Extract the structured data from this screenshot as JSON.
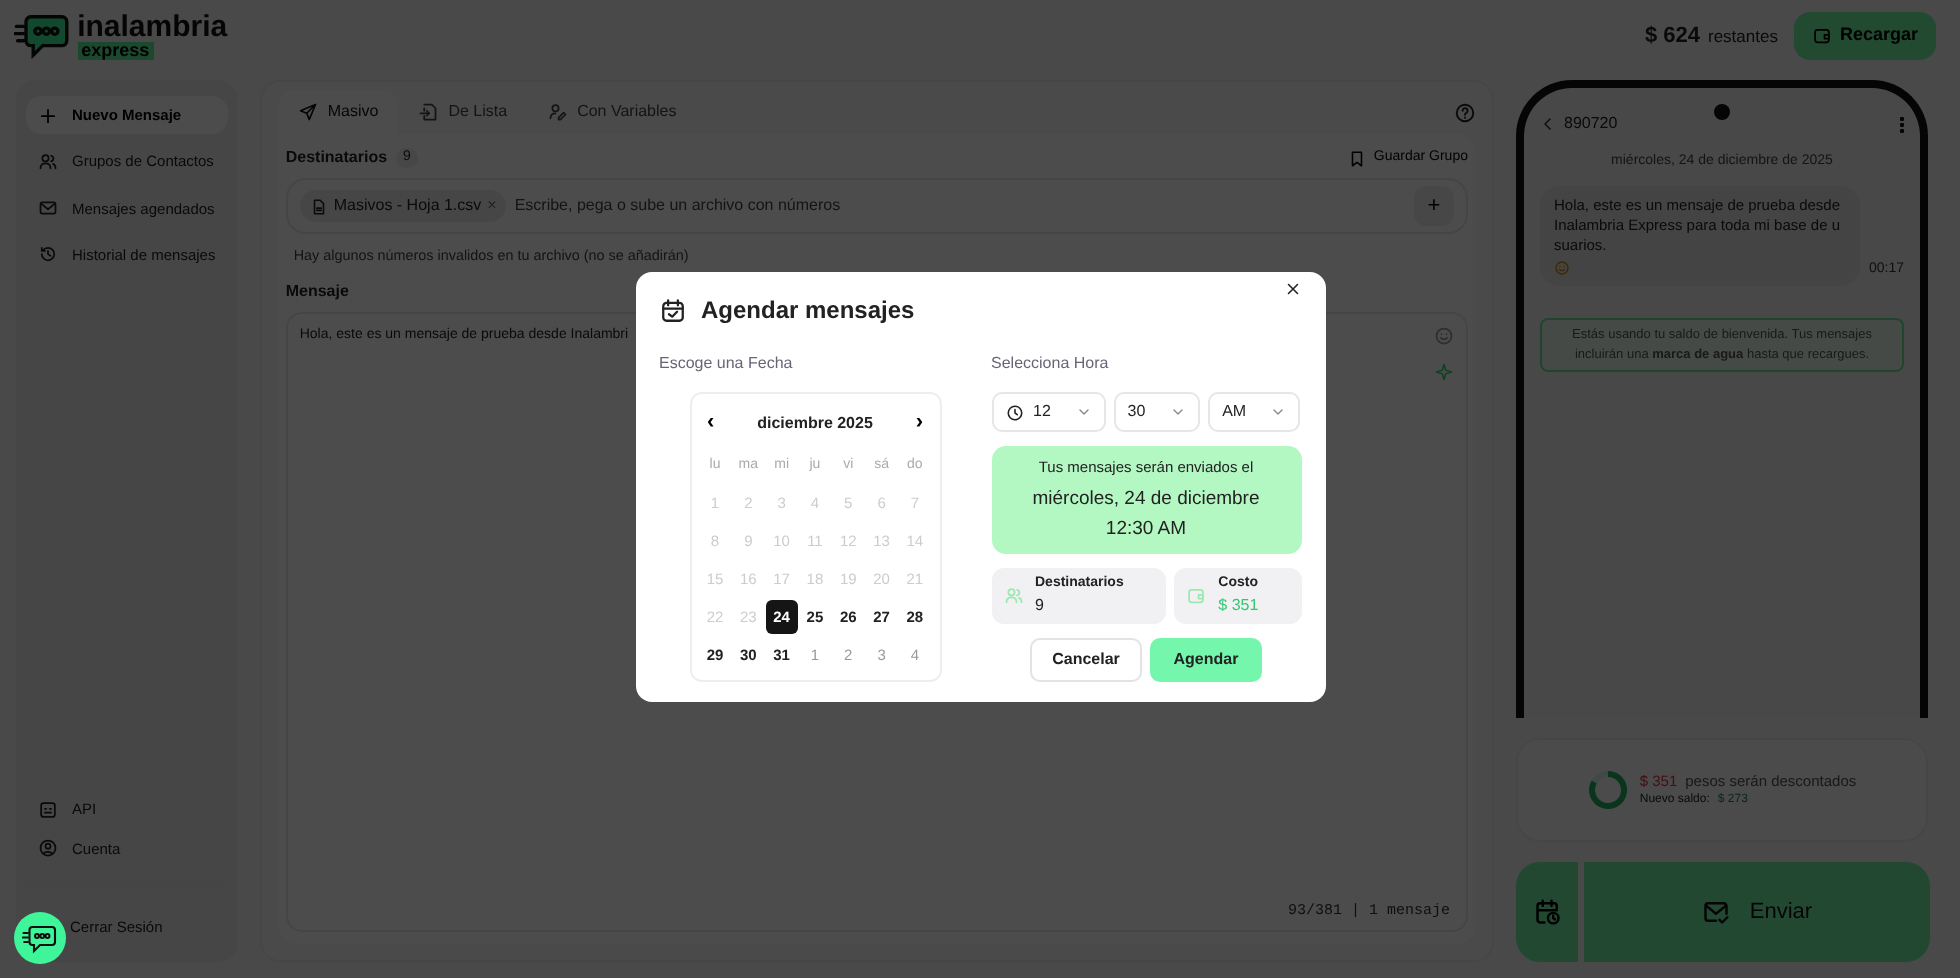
{
  "header": {
    "brand": "inalambria",
    "brand_sub": "express",
    "balance": "$ 624",
    "balance_suffix": "restantes",
    "recharge": "Recargar"
  },
  "sidebar": {
    "items": [
      {
        "label": "Nuevo Mensaje",
        "selected": true
      },
      {
        "label": "Grupos de Contactos",
        "selected": false
      },
      {
        "label": "Mensajes agendados",
        "selected": false
      },
      {
        "label": "Historial de mensajes",
        "selected": false
      }
    ],
    "bottom_items": [
      {
        "label": "API",
        "selected": false
      },
      {
        "label": "Cuenta",
        "selected": false
      }
    ],
    "logout": "Cerrar Sesión"
  },
  "tabs": [
    {
      "label": "Masivo",
      "selected": true
    },
    {
      "label": "De Lista",
      "selected": false
    },
    {
      "label": "Con Variables",
      "selected": false
    }
  ],
  "recipients": {
    "label": "Destinatarios",
    "count": "9",
    "save": "Guardar Grupo",
    "chip": "Masivos - Hoja 1.csv",
    "chip_close": "×",
    "placeholder": "Escribe, pega o sube un archivo con números",
    "add": "+",
    "warning": "Hay algunos números invalidos en tu archivo (no se añadirán)"
  },
  "message": {
    "label": "Mensaje",
    "text": "Hola, este es un mensaje de prueba desde Inalambri",
    "counter": "93/381 | 1 mensaje"
  },
  "phone": {
    "contact": "890720",
    "date": "miércoles, 24 de diciembre de 2025",
    "bubble": "Hola, este es un mensaje de prueba desde Inalambria Express para toda mi base de usuarios.",
    "time": "00:17",
    "notice": "Estás usando tu saldo de bienvenida. Tus mensajes incluirán una **marca de agua** hasta que recargues."
  },
  "summary": {
    "amount": "$ 351",
    "text": "pesos serán descontados",
    "new_balance_label": "Nuevo saldo:",
    "new_balance": "$ 273"
  },
  "send": {
    "label": "Enviar"
  },
  "modal": {
    "title": "Agendar mensajes",
    "date_label": "Escoge una Fecha",
    "month": "diciembre 2025",
    "prev": "‹",
    "next": "›",
    "weekdays": [
      "lu",
      "ma",
      "mi",
      "ju",
      "vi",
      "sá",
      "do"
    ],
    "weeks": [
      [
        {
          "label": "1",
          "kind": "past",
          "selected": false
        },
        {
          "label": "2",
          "kind": "past",
          "selected": false
        },
        {
          "label": "3",
          "kind": "past",
          "selected": false
        },
        {
          "label": "4",
          "kind": "past",
          "selected": false
        },
        {
          "label": "5",
          "kind": "past",
          "selected": false
        },
        {
          "label": "6",
          "kind": "past",
          "selected": false
        },
        {
          "label": "7",
          "kind": "past",
          "selected": false
        }
      ],
      [
        {
          "label": "8",
          "kind": "past",
          "selected": false
        },
        {
          "label": "9",
          "kind": "past",
          "selected": false
        },
        {
          "label": "10",
          "kind": "past",
          "selected": false
        },
        {
          "label": "11",
          "kind": "past",
          "selected": false
        },
        {
          "label": "12",
          "kind": "past",
          "selected": false
        },
        {
          "label": "13",
          "kind": "past",
          "selected": false
        },
        {
          "label": "14",
          "kind": "past",
          "selected": false
        }
      ],
      [
        {
          "label": "15",
          "kind": "past",
          "selected": false
        },
        {
          "label": "16",
          "kind": "past",
          "selected": false
        },
        {
          "label": "17",
          "kind": "past",
          "selected": false
        },
        {
          "label": "18",
          "kind": "past",
          "selected": false
        },
        {
          "label": "19",
          "kind": "past",
          "selected": false
        },
        {
          "label": "20",
          "kind": "past",
          "selected": false
        },
        {
          "label": "21",
          "kind": "past",
          "selected": false
        }
      ],
      [
        {
          "label": "22",
          "kind": "past",
          "selected": false
        },
        {
          "label": "23",
          "kind": "past",
          "selected": false
        },
        {
          "label": "24",
          "kind": "current",
          "selected": true
        },
        {
          "label": "25",
          "kind": "current",
          "selected": false
        },
        {
          "label": "26",
          "kind": "current",
          "selected": false
        },
        {
          "label": "27",
          "kind": "current",
          "selected": false
        },
        {
          "label": "28",
          "kind": "current",
          "selected": false
        }
      ],
      [
        {
          "label": "29",
          "kind": "current",
          "selected": false
        },
        {
          "label": "30",
          "kind": "current",
          "selected": false
        },
        {
          "label": "31",
          "kind": "current",
          "selected": false
        },
        {
          "label": "1",
          "kind": "next",
          "selected": false
        },
        {
          "label": "2",
          "kind": "next",
          "selected": false
        },
        {
          "label": "3",
          "kind": "next",
          "selected": false
        },
        {
          "label": "4",
          "kind": "next",
          "selected": false
        }
      ]
    ],
    "time_label": "Selecciona Hora",
    "selects": [
      {
        "value": "12",
        "clock": true
      },
      {
        "value": "30",
        "clock": false
      },
      {
        "value": "AM",
        "clock": false
      }
    ],
    "schedule_intro": "Tus mensajes serán enviados el",
    "schedule_date": "miércoles, 24 de diciembre",
    "schedule_time": "12:30 AM",
    "stats": [
      {
        "label": "Destinatarios",
        "value": "9"
      },
      {
        "label": "Costo",
        "value": "$ 351"
      }
    ],
    "buttons": [
      {
        "label": "Cancelar",
        "kind": "secondary"
      },
      {
        "label": "Agendar",
        "kind": "primary"
      }
    ]
  }
}
